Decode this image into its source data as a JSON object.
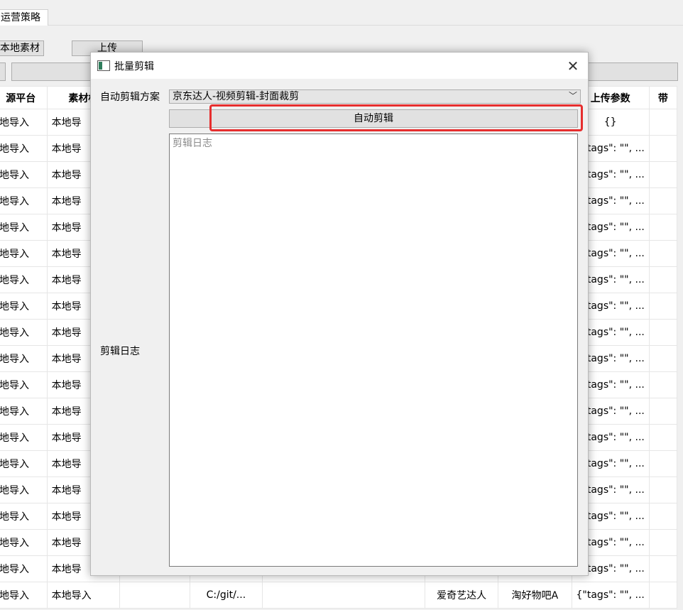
{
  "main_window": {
    "tab_label": "运营策略",
    "local_material_button": "本地素材",
    "upload_button": "上传",
    "table": {
      "headers": [
        "源平台",
        "素材标",
        "",
        "",
        "",
        "",
        "",
        "上传参数",
        "带"
      ],
      "rows": [
        [
          "地导入",
          "本地导",
          "",
          "",
          "",
          "",
          "",
          "{}",
          ""
        ],
        [
          "地导入",
          "本地导",
          "",
          "",
          "",
          "",
          "",
          "{\"tags\": \"\", ...",
          ""
        ],
        [
          "地导入",
          "本地导",
          "",
          "",
          "",
          "",
          "",
          "{\"tags\": \"\", ...",
          ""
        ],
        [
          "地导入",
          "本地导",
          "",
          "",
          "",
          "",
          "",
          "{\"tags\": \"\", ...",
          ""
        ],
        [
          "地导入",
          "本地导",
          "",
          "",
          "",
          "",
          "",
          "{\"tags\": \"\", ...",
          ""
        ],
        [
          "地导入",
          "本地导",
          "",
          "",
          "",
          "",
          "",
          "{\"tags\": \"\", ...",
          ""
        ],
        [
          "地导入",
          "本地导",
          "",
          "",
          "",
          "",
          "",
          "{\"tags\": \"\", ...",
          ""
        ],
        [
          "地导入",
          "本地导",
          "",
          "",
          "",
          "",
          "",
          "{\"tags\": \"\", ...",
          ""
        ],
        [
          "地导入",
          "本地导",
          "",
          "",
          "",
          "",
          "",
          "{\"tags\": \"\", ...",
          ""
        ],
        [
          "地导入",
          "本地导",
          "",
          "",
          "",
          "",
          "",
          "{\"tags\": \"\", ...",
          ""
        ],
        [
          "地导入",
          "本地导",
          "",
          "",
          "",
          "",
          "",
          "{\"tags\": \"\", ...",
          ""
        ],
        [
          "地导入",
          "本地导",
          "",
          "",
          "",
          "",
          "",
          "{\"tags\": \"\", ...",
          ""
        ],
        [
          "地导入",
          "本地导",
          "",
          "",
          "",
          "",
          "",
          "{\"tags\": \"\", ...",
          ""
        ],
        [
          "地导入",
          "本地导",
          "",
          "",
          "",
          "",
          "",
          "{\"tags\": \"\", ...",
          ""
        ],
        [
          "地导入",
          "本地导",
          "",
          "",
          "",
          "",
          "",
          "{\"tags\": \"\", ...",
          ""
        ],
        [
          "地导入",
          "本地导",
          "",
          "",
          "",
          "",
          "",
          "{\"tags\": \"\", ...",
          ""
        ],
        [
          "地导入",
          "本地导",
          "",
          "",
          "",
          "",
          "",
          "{\"tags\": \"\", ...",
          ""
        ],
        [
          "地导入",
          "本地导",
          "",
          "",
          "",
          "",
          "",
          "{\"tags\": \"\", ...",
          ""
        ],
        [
          "地导入",
          "本地导入",
          "",
          "C:/git/...",
          "",
          "爱奇艺达人",
          "淘好物吧A",
          "{\"tags\": \"\", ...",
          ""
        ]
      ]
    }
  },
  "dialog": {
    "title": "批量剪辑",
    "close_icon": "close-icon",
    "scheme_label": "自动剪辑方案",
    "scheme_value": "京东达人-视频剪辑-封面裁剪",
    "auto_edit_button": "自动剪辑",
    "log_label": "剪辑日志",
    "log_placeholder": "剪辑日志",
    "log_value": "",
    "highlight_color": "#e62e2e"
  }
}
